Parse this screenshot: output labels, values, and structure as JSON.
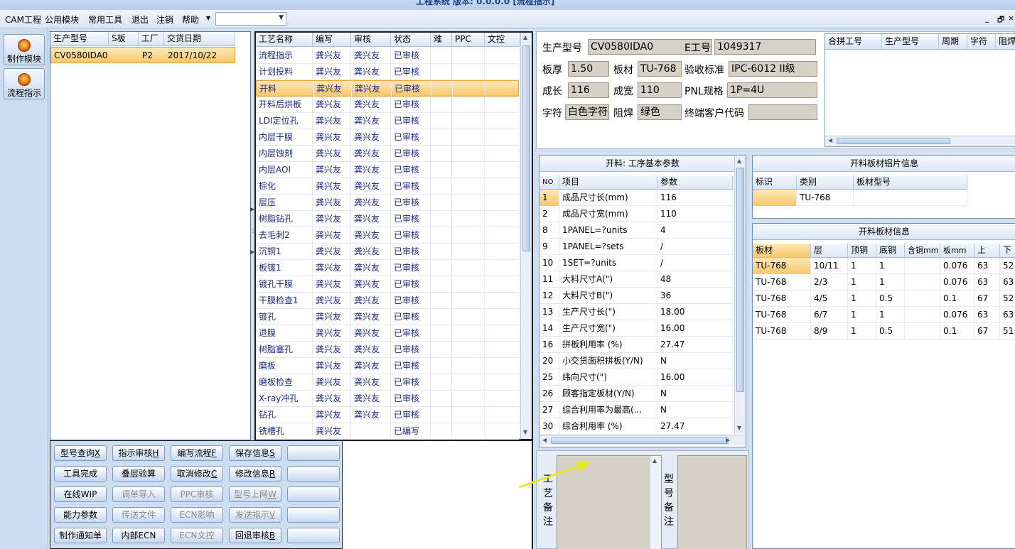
{
  "window": {
    "title": "工程系统 版本: 0.0.0.0  [流程指示]"
  },
  "menu": {
    "items": [
      "CAM工程",
      "公用模块",
      "常用工具",
      "退出",
      "注销",
      "帮助"
    ],
    "combo_value": ""
  },
  "window_controls": {
    "minimize": "_",
    "restore": "🗗",
    "close": "×"
  },
  "nav": {
    "items": [
      {
        "label": "制作模块",
        "icon": "fire-icon"
      },
      {
        "label": "流程指示",
        "icon": "flow-icon"
      }
    ]
  },
  "orders": {
    "columns": [
      "生产型号",
      "S板",
      "工厂",
      "交货日期"
    ],
    "rows": [
      [
        "CV0580IDA0",
        "",
        "P2",
        "2017/10/22"
      ]
    ]
  },
  "process": {
    "columns": [
      "工艺名称",
      "编写",
      "审核",
      "状态",
      "难",
      "PPC",
      "文控"
    ],
    "rows": [
      [
        "流程指示",
        "龚兴友",
        "龚兴友",
        "已审核"
      ],
      [
        "计划投料",
        "龚兴友",
        "龚兴友",
        "已审核"
      ],
      [
        "开料",
        "龚兴友",
        "龚兴友",
        "已审核"
      ],
      [
        "开料后烘板",
        "龚兴友",
        "龚兴友",
        "已审核"
      ],
      [
        "LDI定位孔",
        "龚兴友",
        "龚兴友",
        "已审核"
      ],
      [
        "内层干膜",
        "龚兴友",
        "龚兴友",
        "已审核"
      ],
      [
        "内层蚀刻",
        "龚兴友",
        "龚兴友",
        "已审核"
      ],
      [
        "内层AOI",
        "龚兴友",
        "龚兴友",
        "已审核"
      ],
      [
        "棕化",
        "龚兴友",
        "龚兴友",
        "已审核"
      ],
      [
        "层压",
        "龚兴友",
        "龚兴友",
        "已审核"
      ],
      [
        "树脂钻孔",
        "龚兴友",
        "龚兴友",
        "已审核"
      ],
      [
        "去毛刺2",
        "龚兴友",
        "龚兴友",
        "已审核"
      ],
      [
        "沉铜1",
        "龚兴友",
        "龚兴友",
        "已审核"
      ],
      [
        "板镀1",
        "龚兴友",
        "龚兴友",
        "已审核"
      ],
      [
        "镀孔干膜",
        "龚兴友",
        "龚兴友",
        "已审核"
      ],
      [
        "干膜检查1",
        "龚兴友",
        "龚兴友",
        "已审核"
      ],
      [
        "镀孔",
        "龚兴友",
        "龚兴友",
        "已审核"
      ],
      [
        "退膜",
        "龚兴友",
        "龚兴友",
        "已审核"
      ],
      [
        "树脂塞孔",
        "龚兴友",
        "龚兴友",
        "已审核"
      ],
      [
        "磨板",
        "龚兴友",
        "龚兴友",
        "已审核"
      ],
      [
        "磨板检查",
        "龚兴友",
        "龚兴友",
        "已审核"
      ],
      [
        "X-ray冲孔",
        "龚兴友",
        "龚兴友",
        "已审核"
      ],
      [
        "钻孔",
        "龚兴友",
        "龚兴友",
        "已审核"
      ],
      [
        "铣槽孔",
        "龚兴友",
        "",
        "已编写"
      ]
    ],
    "selected_index": 2
  },
  "info": {
    "fields": [
      {
        "label": "生产型号",
        "value": "CV0580IDA0"
      },
      {
        "label": "E工号",
        "value": "1049317"
      },
      {
        "label": "板厚",
        "value": "1.50"
      },
      {
        "label": "板材",
        "value": "TU-768"
      },
      {
        "label": "验收标准",
        "value": "IPC-6012 II级"
      },
      {
        "label": "成长",
        "value": "116"
      },
      {
        "label": "成宽",
        "value": "110"
      },
      {
        "label": "PNL规格",
        "value": "1P=4U"
      },
      {
        "label": "字符",
        "value": "白色字符"
      },
      {
        "label": "阻焊",
        "value": "绿色"
      },
      {
        "label": "终端客户代码",
        "value": ""
      }
    ],
    "merge_columns": [
      "合拼工号",
      "生产型号",
      "周期",
      "字符",
      "阻焊"
    ]
  },
  "params": {
    "title": "开料: 工序基本参数",
    "columns": [
      "NO",
      "项目",
      "参数"
    ],
    "rows": [
      [
        "1",
        "成品尺寸长(mm)",
        "116"
      ],
      [
        "2",
        "成品尺寸宽(mm)",
        "110"
      ],
      [
        "8",
        "1PANEL=?units",
        "4"
      ],
      [
        "9",
        "1PANEL=?sets",
        "/"
      ],
      [
        "10",
        "1SET=?units",
        "/"
      ],
      [
        "11",
        "大料尺寸A(\")",
        "48"
      ],
      [
        "12",
        "大料尺寸B(\")",
        "36"
      ],
      [
        "13",
        "生产尺寸长(\")",
        "18.00"
      ],
      [
        "14",
        "生产尺寸宽(\")",
        "16.00"
      ],
      [
        "16",
        "拼板利用率 (%)",
        "27.47"
      ],
      [
        "20",
        "小交货面积拼板(Y/N)",
        "N"
      ],
      [
        "25",
        "纬向尺寸(\")",
        "16.00"
      ],
      [
        "26",
        "顾客指定板材(Y/N)",
        "N"
      ],
      [
        "27",
        "综合利用率为最高(...",
        "N"
      ],
      [
        "30",
        "综合利用率 (%)",
        "27.47"
      ]
    ]
  },
  "sheet_info": {
    "title": "开料板材铝片信息",
    "columns": [
      "标识",
      "类别",
      "板材型号"
    ],
    "rows": [
      [
        "",
        "TU-768",
        ""
      ]
    ]
  },
  "board_info": {
    "title": "开料板材信息",
    "columns": [
      "板材",
      "层",
      "顶铜",
      "底铜",
      "含铜mm",
      "板mm",
      "上",
      "下"
    ],
    "rows": [
      [
        "TU-768",
        "10/11",
        "1",
        "1",
        "",
        "0.076",
        "63",
        "52"
      ],
      [
        "TU-768",
        "2/3",
        "1",
        "1",
        "",
        "0.076",
        "63",
        "63"
      ],
      [
        "TU-768",
        "4/5",
        "1",
        "0.5",
        "",
        "0.1",
        "67",
        "52"
      ],
      [
        "TU-768",
        "6/7",
        "1",
        "1",
        "",
        "0.076",
        "63",
        "63"
      ],
      [
        "TU-768",
        "8/9",
        "1",
        "0.5",
        "",
        "0.1",
        "67",
        "51"
      ]
    ]
  },
  "actions": [
    [
      {
        "label": "型号查询",
        "key": "X"
      },
      {
        "label": "指示审核",
        "key": "H"
      },
      {
        "label": "编写流程",
        "key": "F"
      },
      {
        "label": "保存信息",
        "key": "S"
      },
      {
        "label": "",
        "key": ""
      }
    ],
    [
      {
        "label": "工具完成",
        "key": ""
      },
      {
        "label": "叠层验算",
        "key": ""
      },
      {
        "label": "取消修改",
        "key": "C"
      },
      {
        "label": "修改信息",
        "key": "R"
      },
      {
        "label": "",
        "key": ""
      }
    ],
    [
      {
        "label": "在线WIP",
        "key": ""
      },
      {
        "label": "调单导入",
        "key": ""
      },
      {
        "label": "PPC审核",
        "key": ""
      },
      {
        "label": "型号上网",
        "key": "W"
      },
      {
        "label": "",
        "key": ""
      }
    ],
    [
      {
        "label": "能力参数",
        "key": ""
      },
      {
        "label": "传送文件",
        "key": ""
      },
      {
        "label": "ECN影响",
        "key": ""
      },
      {
        "label": "发送指示",
        "key": "V"
      },
      {
        "label": "",
        "key": ""
      }
    ],
    [
      {
        "label": "制作通知单",
        "key": ""
      },
      {
        "label": "内部ECN",
        "key": ""
      },
      {
        "label": "ECN文控",
        "key": ""
      },
      {
        "label": "回退审核",
        "key": "B"
      },
      {
        "label": "",
        "key": ""
      }
    ]
  ],
  "remarks": {
    "process_label": "工艺备注",
    "model_label": "型号备注",
    "process_text": "",
    "model_text": ""
  }
}
